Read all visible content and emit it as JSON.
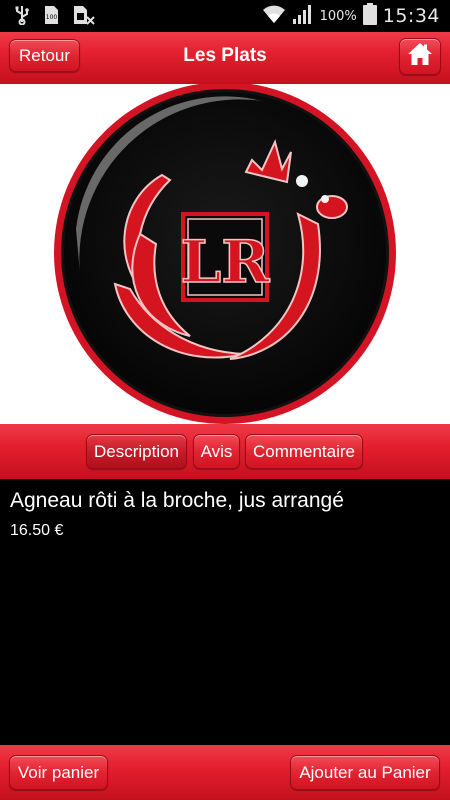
{
  "status_bar": {
    "battery_percent": "100%",
    "time": "15:34",
    "icons": [
      "usb-icon",
      "sd-card-icon",
      "sim-icon",
      "wifi-icon",
      "signal-icon",
      "battery-icon"
    ]
  },
  "header": {
    "back_label": "Retour",
    "title": "Les Plats",
    "home_icon": "home-icon"
  },
  "logo": {
    "text": "LR"
  },
  "tabs": [
    {
      "label": "Description",
      "active": true
    },
    {
      "label": "Avis",
      "active": false
    },
    {
      "label": "Commentaire",
      "active": false
    }
  ],
  "dish": {
    "name": "Agneau rôti à la broche, jus arrangé",
    "price": "16.50 €"
  },
  "footer": {
    "cart_label": "Voir panier",
    "add_label": "Ajouter au Panier"
  },
  "colors": {
    "brand_red": "#e4202f",
    "background": "#000000"
  }
}
